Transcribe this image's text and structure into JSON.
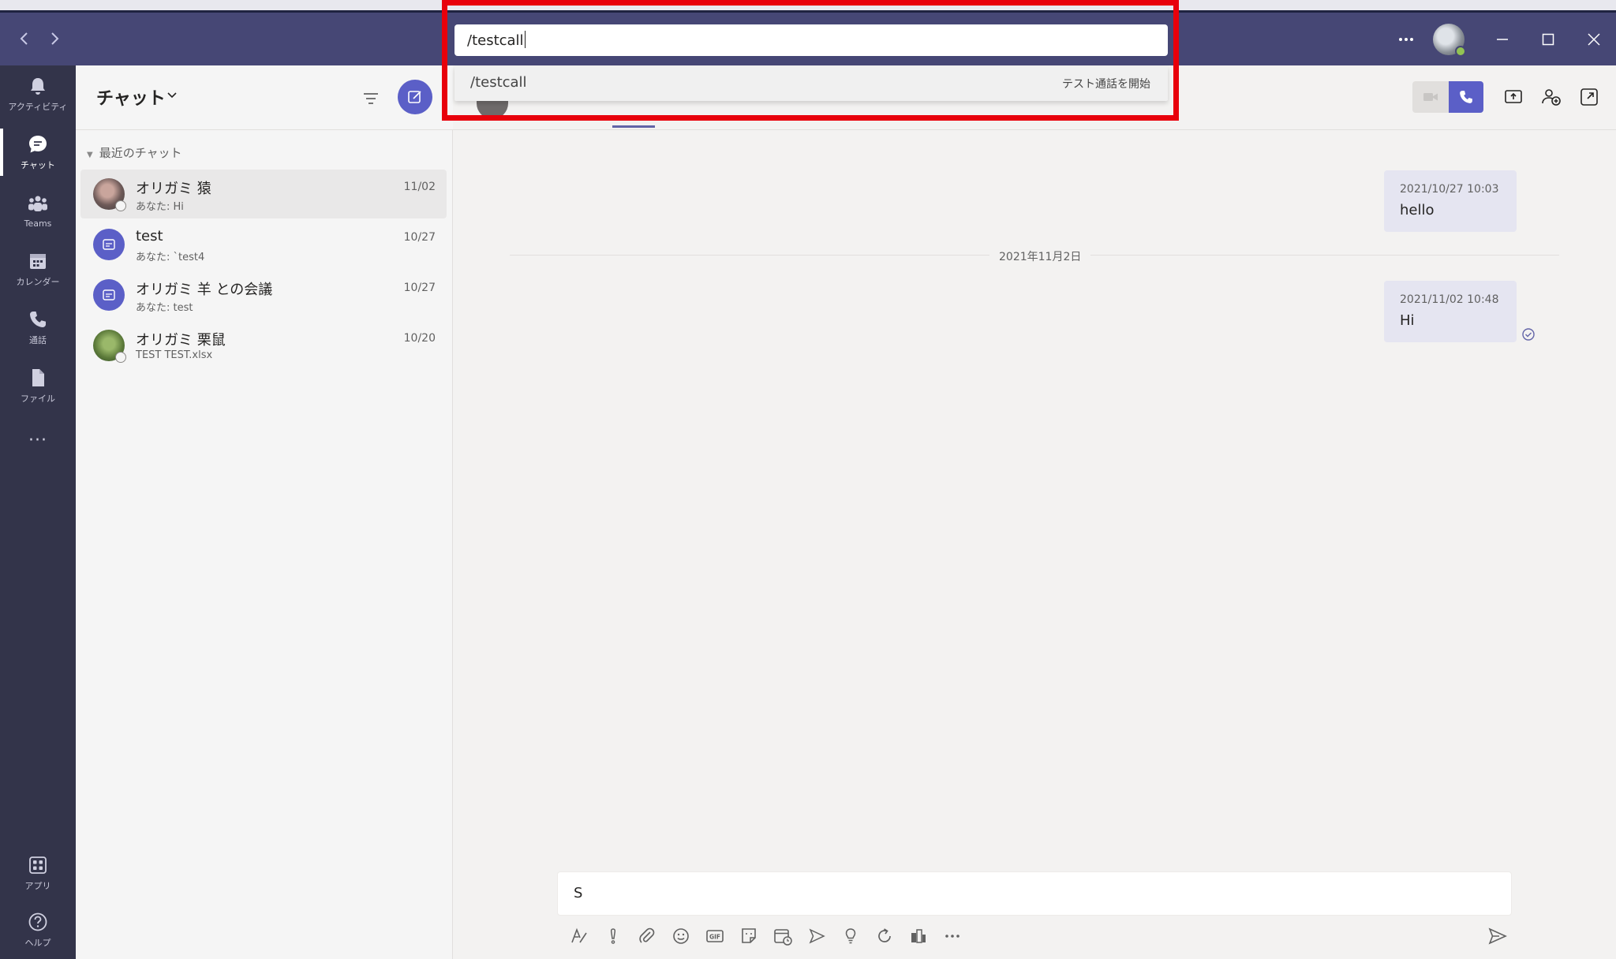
{
  "command_bar": {
    "value": "/testcall",
    "suggestion": {
      "command": "/testcall",
      "description": "テスト通話を開始"
    }
  },
  "rail": {
    "items": [
      {
        "label": "アクティビティ",
        "icon": "bell-icon"
      },
      {
        "label": "チャット",
        "icon": "chat-icon",
        "active": true
      },
      {
        "label": "Teams",
        "icon": "teams-icon"
      },
      {
        "label": "カレンダー",
        "icon": "calendar-icon"
      },
      {
        "label": "通話",
        "icon": "phone-icon"
      },
      {
        "label": "ファイル",
        "icon": "file-icon"
      }
    ],
    "more": "···",
    "apps_label": "アプリ",
    "help_label": "ヘルプ"
  },
  "chat_list": {
    "title": "チャット",
    "section": "最近のチャット",
    "chats": [
      {
        "name": "オリガミ 猿",
        "preview": "あなた: Hi",
        "date": "11/02"
      },
      {
        "name": "test",
        "preview": "あなた: `test4",
        "date": "10/27"
      },
      {
        "name": "オリガミ 羊 との会議",
        "preview": "あなた: test",
        "date": "10/27"
      },
      {
        "name": "オリガミ 栗鼠",
        "preview": "TEST TEST.xlsx",
        "date": "10/20"
      }
    ]
  },
  "conversation": {
    "messages": [
      {
        "time": "2021/10/27 10:03",
        "text": "hello"
      },
      {
        "time": "2021/11/02 10:48",
        "text": "Hi"
      }
    ],
    "date_divider": "2021年11月2日",
    "compose_value": "S"
  },
  "colors": {
    "titlebar": "#464775",
    "rail": "#33344a",
    "accent": "#5b5fc7",
    "highlight": "#e8000b"
  }
}
